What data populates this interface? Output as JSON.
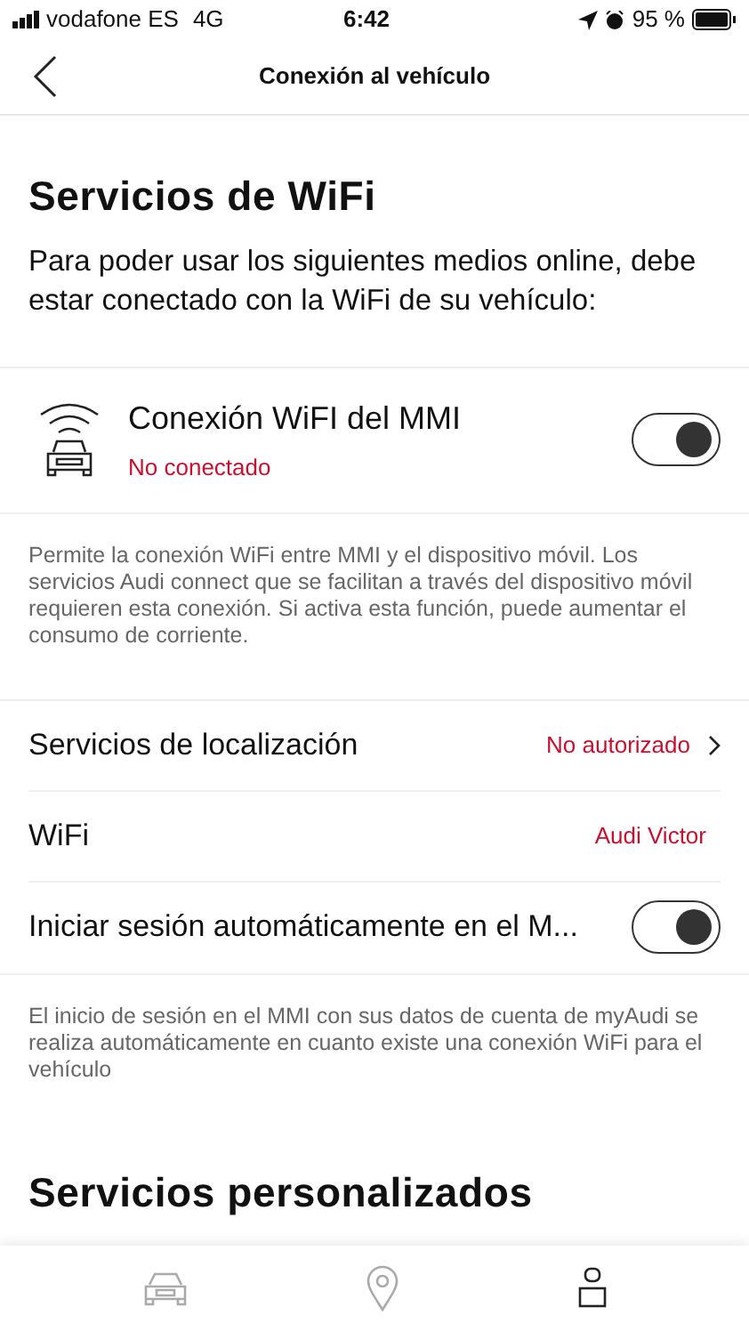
{
  "status_bar": {
    "carrier": "vodafone ES",
    "network": "4G",
    "time": "6:42",
    "battery": "95 %"
  },
  "nav": {
    "title": "Conexión al vehículo"
  },
  "wifi_section": {
    "title": "Servicios de WiFi",
    "intro": "Para poder usar los siguientes medios online, debe estar conectado con la WiFi de su vehículo:"
  },
  "mmi_wifi": {
    "label": "Conexión WiFI del MMI",
    "status": "No conectado",
    "on": true,
    "description": "Permite la conexión WiFi entre MMI y el dispositivo móvil. Los servicios Audi connect que se facilitan a través del dispositivo móvil requieren esta conexión. Si activa esta función, puede aumentar el consumo de corriente."
  },
  "settings": [
    {
      "kind": "link",
      "label": "Servicios de localización",
      "value": "No autorizado"
    },
    {
      "kind": "value",
      "label": "WiFi",
      "value": "Audi Victor"
    },
    {
      "kind": "toggle",
      "label": "Iniciar sesión automáticamente en el M...",
      "on": true
    }
  ],
  "auto_login_note": "El inicio de sesión en el MMI con sus datos de cuenta de myAudi se realiza automáticamente en cuanto existe una conexión WiFi para el vehículo",
  "personal_section": {
    "title": "Servicios personalizados"
  },
  "tab_bar": [
    {
      "kind": "car",
      "selected": false
    },
    {
      "kind": "pin",
      "selected": false
    },
    {
      "kind": "person",
      "selected": true
    }
  ]
}
